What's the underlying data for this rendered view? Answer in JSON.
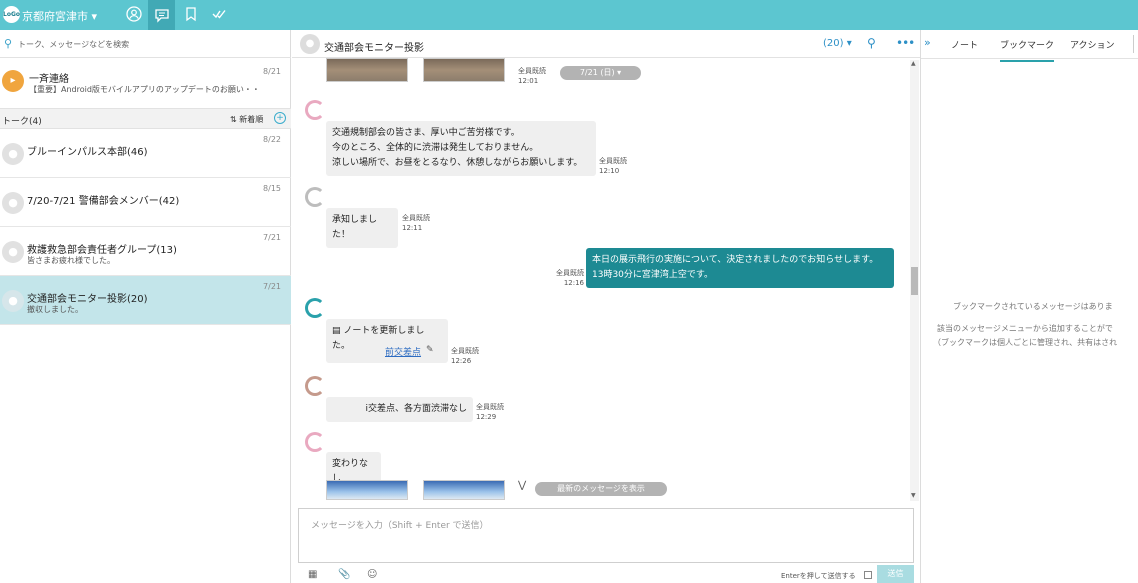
{
  "topbar": {
    "logo": "LoGo",
    "org_name": "京都府宮津市 ▾",
    "icons": [
      "profile-icon",
      "chat-icon",
      "bookmark-icon",
      "check-icon"
    ]
  },
  "sidebar": {
    "search_placeholder": "トーク、メッセージなどを検索",
    "broadcast": {
      "name": "一斉連絡",
      "preview": "【重要】Android版モバイルアプリのアップデートのお願い・・",
      "date": "8/21"
    },
    "talk_header": {
      "label": "トーク(4)",
      "sort_label": "⇅ 新着順",
      "add_icon": "plus-icon"
    },
    "talks": [
      {
        "name": "ブルーインパルス本部(46)",
        "preview": "",
        "date": "8/22"
      },
      {
        "name": "7/20-7/21 警備部会メンバー(42)",
        "preview": "",
        "date": "8/15"
      },
      {
        "name": "救護救急部会責任者グループ(13)",
        "preview": "皆さまお疲れ様でした。",
        "date": "7/21"
      },
      {
        "name": "交通部会モニター投影(20)",
        "preview": "撤収しました。",
        "date": "7/21",
        "selected": true
      }
    ]
  },
  "chat": {
    "title": "交通部会モニター投影",
    "member_count": "(20) ▾",
    "date_pill": "7/21 (日) ▾",
    "messages": [
      {
        "type": "photos",
        "meta_read": "全員既読",
        "meta_time": "12:01"
      },
      {
        "type": "text",
        "lines": [
          "交通規制部会の皆さま、厚い中ご苦労様です。",
          "今のところ、全体的に渋滞は発生しておりません。",
          "涼しい場所で、お昼をとるなり、休憩しながらお願いします。"
        ],
        "meta_read": "全員既読",
        "meta_time": "12:10"
      },
      {
        "type": "text",
        "lines": [
          "承知しました！"
        ],
        "meta_read": "全員既読",
        "meta_time": "12:11"
      },
      {
        "type": "outgoing",
        "lines": [
          "本日の展示飛行の実施について、決定されましたのでお知らせします。",
          "13時30分に宮津湾上空です。"
        ],
        "meta_read": "全員既読",
        "meta_time": "12:16"
      },
      {
        "type": "note",
        "label": "ノートを更新しました。",
        "link": "前交差点",
        "meta_read": "全員既読",
        "meta_time": "12:26"
      },
      {
        "type": "text",
        "lines": [
          "i交差点、各方面渋滞なし"
        ],
        "meta_read": "全員既読",
        "meta_time": "12:29"
      },
      {
        "type": "text",
        "lines": [
          "変わりなし"
        ]
      },
      {
        "type": "photos_bottom"
      }
    ],
    "latest_button": "最新のメッセージを表示",
    "composer_placeholder": "メッセージを入力（Shift + Enter で送信）",
    "enter_to_send": "Enterを押して送信する",
    "send_label": "送信"
  },
  "rightpanel": {
    "tabs": [
      "ノート",
      "ブックマーク",
      "アクション"
    ],
    "active_tab": "ブックマーク",
    "empty_line1": "ブックマークされているメッセージはありま",
    "empty_line2": "該当のメッセージメニューから追加することがで",
    "empty_line3": "（ブックマークは個人ごとに管理され、共有はされ"
  },
  "colors": {
    "topbar": "#5cc6d0",
    "accent": "#2aa1ab",
    "outgoing_bubble": "#1d8a93",
    "selected_row": "#c3e5ea"
  }
}
